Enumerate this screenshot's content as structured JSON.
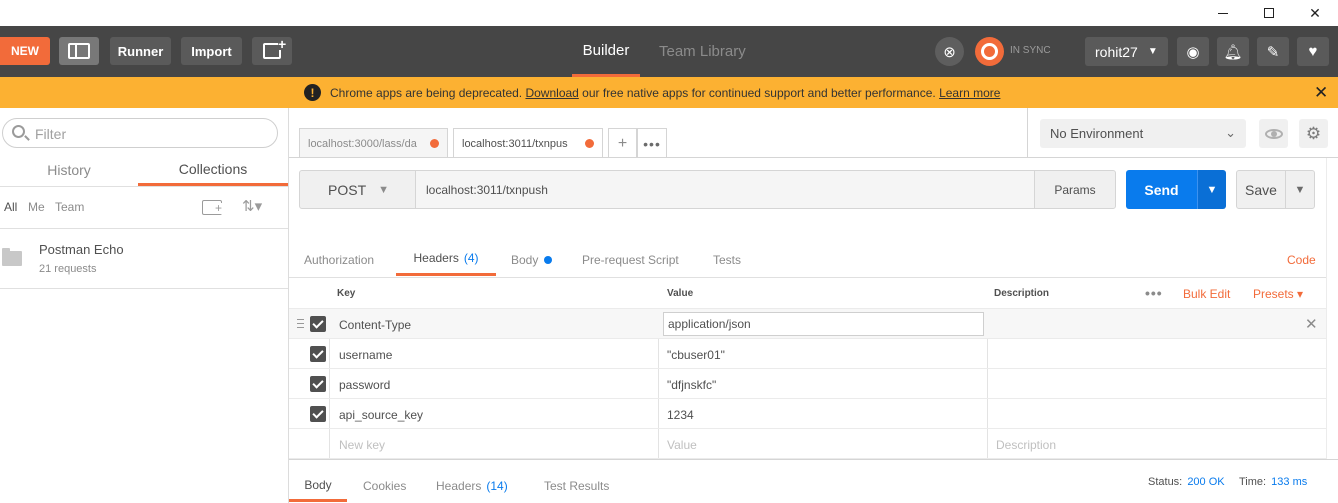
{
  "app": {
    "colors": {
      "accent": "#f26b3a",
      "header": "#464646",
      "banner": "#fcb132",
      "primary": "#097bed"
    }
  },
  "window": {
    "controls": [
      "minimize-icon",
      "maximize-icon",
      "close-icon"
    ]
  },
  "header": {
    "new_label": "NEW",
    "runner_label": "Runner",
    "import_label": "Import",
    "tab_builder": "Builder",
    "tab_team_library": "Team Library",
    "sync_label": "IN SYNC",
    "user": "rohit27",
    "icons": [
      "sidebar-toggle-icon",
      "new-window-icon",
      "interceptor-icon",
      "sync-icon",
      "globe-icon",
      "bell-icon",
      "wrench-icon",
      "heart-icon"
    ]
  },
  "banner": {
    "text_before": "Chrome apps are being deprecated. ",
    "download_link": "Download",
    "text_after": " our free native apps for continued support and better performance. ",
    "learn_more": "Learn more",
    "close_icon": "✕"
  },
  "sidebar": {
    "filter_placeholder": "Filter",
    "tab_history": "History",
    "tab_collections": "Collections",
    "filters": {
      "all": "All",
      "me": "Me",
      "team": "Team"
    },
    "collections": [
      {
        "name": "Postman Echo",
        "count": "21 requests"
      }
    ]
  },
  "tabs": {
    "items": [
      {
        "url": "localhost:3000/lass/da"
      },
      {
        "url": "localhost:3011/txnpus"
      }
    ],
    "add_label": "+",
    "more_label": "•••"
  },
  "environment": {
    "selected": "No Environment"
  },
  "request": {
    "method": "POST",
    "url": "localhost:3011/txnpush",
    "params_label": "Params",
    "send_label": "Send",
    "save_label": "Save",
    "tabs": {
      "authorization": "Authorization",
      "headers": "Headers",
      "headers_count": "(4)",
      "body": "Body",
      "pre_request": "Pre-request Script",
      "tests": "Tests"
    },
    "code_label": "Code"
  },
  "headers_table": {
    "col_key": "Key",
    "col_value": "Value",
    "col_description": "Description",
    "more_label": "•••",
    "bulk_edit": "Bulk Edit",
    "presets": "Presets ▾",
    "rows": [
      {
        "key": "Content-Type",
        "value": "application/json",
        "checked": true
      },
      {
        "key": "username",
        "value": "\"cbuser01\"",
        "checked": true
      },
      {
        "key": "password",
        "value": "\"dfjnskfc\"",
        "checked": true
      },
      {
        "key": "api_source_key",
        "value": "1234",
        "checked": true
      }
    ],
    "new_key_placeholder": "New key",
    "value_placeholder": "Value",
    "description_placeholder": "Description"
  },
  "response": {
    "tab_body": "Body",
    "tab_cookies": "Cookies",
    "tab_headers": "Headers",
    "headers_count": "(14)",
    "tab_test_results": "Test Results",
    "status_label": "Status:",
    "status_value": "200 OK",
    "time_label": "Time:",
    "time_value": "133 ms"
  }
}
